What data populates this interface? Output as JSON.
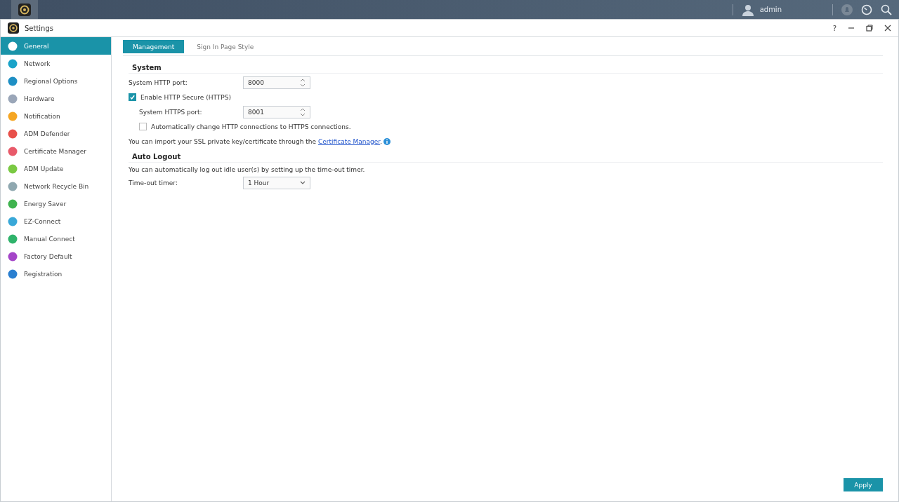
{
  "taskbar": {
    "user": "admin"
  },
  "window": {
    "title": "Settings",
    "help": "?"
  },
  "sidebar": {
    "items": [
      {
        "label": "General",
        "selected": true,
        "color": "#ffffff"
      },
      {
        "label": "Network",
        "selected": false,
        "color": "#1aa3c8"
      },
      {
        "label": "Regional Options",
        "selected": false,
        "color": "#1e8fc4"
      },
      {
        "label": "Hardware",
        "selected": false,
        "color": "#9aa6b8"
      },
      {
        "label": "Notification",
        "selected": false,
        "color": "#f5a623"
      },
      {
        "label": "ADM Defender",
        "selected": false,
        "color": "#e8504a"
      },
      {
        "label": "Certificate Manager",
        "selected": false,
        "color": "#e85a6a"
      },
      {
        "label": "ADM Update",
        "selected": false,
        "color": "#7ac943"
      },
      {
        "label": "Network Recycle Bin",
        "selected": false,
        "color": "#8fa8b0"
      },
      {
        "label": "Energy Saver",
        "selected": false,
        "color": "#3fb34f"
      },
      {
        "label": "EZ-Connect",
        "selected": false,
        "color": "#39a8d8"
      },
      {
        "label": "Manual Connect",
        "selected": false,
        "color": "#2fb36b"
      },
      {
        "label": "Factory Default",
        "selected": false,
        "color": "#a445c8"
      },
      {
        "label": "Registration",
        "selected": false,
        "color": "#2a7fd0"
      }
    ]
  },
  "tabs": [
    {
      "label": "Management",
      "selected": true
    },
    {
      "label": "Sign In Page Style",
      "selected": false
    }
  ],
  "system": {
    "heading": "System",
    "http_port": {
      "label": "System HTTP port:",
      "value": "8000"
    },
    "https_enable": {
      "label": "Enable HTTP Secure (HTTPS)",
      "checked": true
    },
    "https_port": {
      "label": "System HTTPS port:",
      "value": "8001"
    },
    "auto_redirect": {
      "label": "Automatically change HTTP connections to HTTPS connections.",
      "checked": false
    },
    "note": "You can import your SSL private key/certificate through the",
    "note_link": "Certificate Manager",
    "note_end": "."
  },
  "auto_logout": {
    "heading": "Auto Logout",
    "description": "You can automatically log out idle user(s) by setting up the time-out timer.",
    "timer": {
      "label": "Time-out timer:",
      "value": "1 Hour"
    }
  },
  "apply_button": "Apply"
}
